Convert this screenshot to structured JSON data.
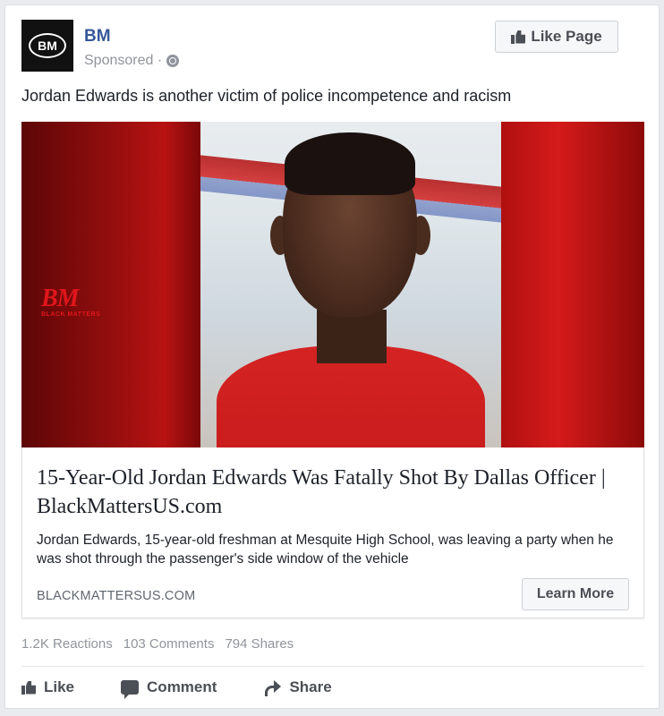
{
  "post": {
    "page_name": "BM",
    "avatar_text": "BM",
    "sponsored": "Sponsored ·",
    "like_page_label": "Like Page",
    "text": "Jordan Edwards is another victim of police incompetence and racism"
  },
  "media": {
    "logo_main": "BM",
    "logo_sub": "BLACK MATTERS"
  },
  "link": {
    "title": "15-Year-Old Jordan Edwards Was Fatally Shot By Dallas Officer | BlackMattersUS.com",
    "description": "Jordan Edwards, 15-year-old freshman at Mesquite High School, was leaving a party when he was shot through the passenger's side window of the vehicle",
    "domain": "BLACKMATTERSUS.COM",
    "cta_label": "Learn More"
  },
  "stats": {
    "reactions": "1.2K Reactions",
    "comments": "103 Comments",
    "shares": "794 Shares"
  },
  "actions": {
    "like": "Like",
    "comment": "Comment",
    "share": "Share"
  },
  "colors": {
    "page_name": "#365899",
    "background": "#e9ebee",
    "logo_red": "#e0161c"
  },
  "icons": [
    "globe-icon",
    "thumbs-up-icon",
    "comment-icon",
    "share-icon"
  ]
}
